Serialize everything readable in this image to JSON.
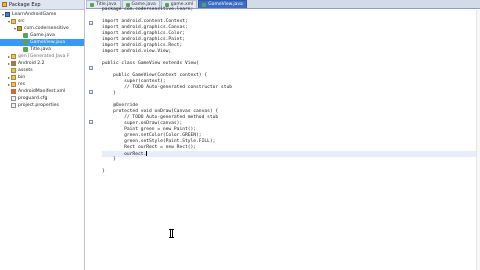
{
  "explorer": {
    "tab_label": "Package Exp",
    "tree": [
      {
        "text": "LearnAndroidGame",
        "indent": 0,
        "icon": "project",
        "toggle": "▾"
      },
      {
        "text": "src",
        "indent": 1,
        "icon": "folder",
        "toggle": "▾"
      },
      {
        "text": "com.codersensitive",
        "indent": 2,
        "icon": "pkg",
        "toggle": "▾"
      },
      {
        "text": "Game.java",
        "indent": 3,
        "icon": "java",
        "toggle": ""
      },
      {
        "text": "GameView.java",
        "indent": 3,
        "icon": "java",
        "toggle": "",
        "selected": true
      },
      {
        "text": "Title.java",
        "indent": 3,
        "icon": "java",
        "toggle": ""
      },
      {
        "text": "gen [Generated Java F",
        "indent": 1,
        "icon": "folder",
        "toggle": "▸",
        "dim": true
      },
      {
        "text": "Android 2.2",
        "indent": 1,
        "icon": "jar",
        "toggle": "▸"
      },
      {
        "text": "assets",
        "indent": 1,
        "icon": "folder",
        "toggle": ""
      },
      {
        "text": "bin",
        "indent": 1,
        "icon": "folder",
        "toggle": "▸"
      },
      {
        "text": "res",
        "indent": 1,
        "icon": "folder",
        "toggle": "▸"
      },
      {
        "text": "AndroidManifest.xml",
        "indent": 1,
        "icon": "xml",
        "toggle": ""
      },
      {
        "text": "proguard.cfg",
        "indent": 1,
        "icon": "file",
        "toggle": ""
      },
      {
        "text": "project.properties",
        "indent": 1,
        "icon": "file",
        "toggle": ""
      }
    ]
  },
  "editor": {
    "tabs": [
      {
        "label": "Title.java",
        "active": false
      },
      {
        "label": "Game.java",
        "active": false
      },
      {
        "label": "game.xml",
        "active": false
      },
      {
        "label": "GameView.java",
        "active": true
      }
    ],
    "code_lines": [
      "package com.codersensitive.learn;",
      "",
      "import android.content.Context;",
      "import android.graphics.Canvas;",
      "import android.graphics.Color;",
      "import android.graphics.Paint;",
      "import android.graphics.Rect;",
      "import android.view.View;",
      "",
      "public class GameView extends View{",
      "",
      "    public GameView(Context context) {",
      "        super(context);",
      "        // TODO Auto-generated constructor stub",
      "    }",
      "",
      "    @Override",
      "    protected void onDraw(Canvas canvas) {",
      "        // TODO Auto-generated method stub",
      "        super.onDraw(canvas);",
      "        Paint green = new Paint();",
      "        green.setColor(Color.GREEN);",
      "        green.setStyle(Paint.Style.FILL);",
      "        Rect ourRect = new Rect();",
      "        ourRect.",
      "    }",
      "",
      "}"
    ],
    "current_line": 24
  }
}
